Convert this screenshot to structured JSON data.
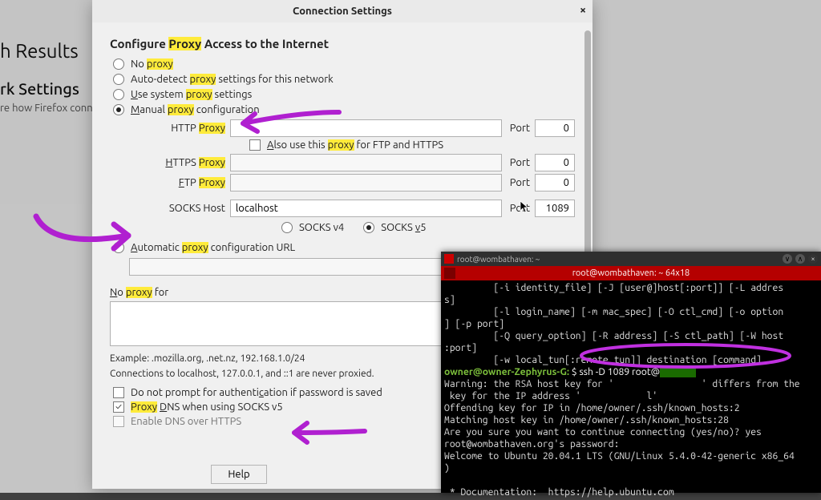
{
  "background": {
    "results_heading": "h Results",
    "settings_heading": "rk Settings",
    "settings_sub": "re how Firefox conne"
  },
  "dialog": {
    "title": "Connection Settings",
    "section_title_pre": "Configure ",
    "section_title_hl": "Proxy",
    "section_title_post": " Access to the Internet",
    "radios": {
      "no_proxy_pre": "No ",
      "no_proxy_hl": "proxy",
      "auto_pre": "Auto-detect ",
      "auto_hl": "proxy",
      "auto_post": " settings for this network",
      "system_pre": "se system ",
      "system_hl": "proxy",
      "system_post": " settings",
      "manual_pre": "anual ",
      "manual_hl": "proxy",
      "manual_post": " configuration",
      "pac_pre": "utomatic ",
      "pac_hl": "proxy",
      "pac_post": " configuration URL"
    },
    "fields": {
      "http_label_pre": "HTTP ",
      "http_label_hl": "Proxy",
      "also_pre": "lso use this ",
      "also_hl": "proxy",
      "also_post": " for FTP and HTTPS",
      "https_label_pre": "TTPS ",
      "https_label_hl": "Proxy",
      "ftp_label_pre": "TP ",
      "ftp_label_hl": "Proxy",
      "socks_label": "SOCKS Host",
      "port_label": "Port",
      "port_http": "0",
      "port_https": "0",
      "port_ftp": "0",
      "socks_host": "localhost",
      "port_socks": "1089",
      "socksv4": "SOCKS v4",
      "socksv5": "SOCKS ",
      "socksv5_u": "v",
      "socksv5_post": "5"
    },
    "noproxy": {
      "label_pre": "o ",
      "label_hl": "proxy",
      "label_post": " for",
      "example": "Example: .mozilla.org, .net.nz, 192.168.1.0/24",
      "never": "Connections to localhost, 127.0.0.1, and ::1 are never proxied."
    },
    "checks": {
      "noprompt": "Do not prompt for authentication if password is saved",
      "proxdns_hl": "Proxy",
      "proxdns_post": " ",
      "proxdns_u": "D",
      "proxdns_rest": "NS when using SOCKS v5",
      "dnsoverhttps": "Enable DNS over HTTPS"
    },
    "buttons": {
      "help": "Help"
    }
  },
  "terminal": {
    "tab_title": "root@wombathaven: ~",
    "title": "root@wombathaven: ~ 64x18",
    "prompt_user": "owner@owner-Zephyrus-G:",
    "lines": [
      "         [-i identity_file] [-J [user@]host[:port]] [-L addres",
      "s]",
      "         [-l login_name] [-m mac_spec] [-O ctl_cmd] [-o option",
      "] [-p port]",
      "         [-Q query_option] [-R address] [-S ctl_path] [-W host",
      ":port]",
      "         [-w local_tun[:remote_tun]] destination [command]",
      "$ ssh -D 1089 root@",
      "Warning: the RSA host key for '                ' differs from the",
      " key for the IP address '            l'",
      "Offending key for IP in /home/owner/.ssh/known_hosts:2",
      "Matching host key in /home/owner/.ssh/known_hosts:28",
      "Are you sure you want to continue connecting (yes/no)? yes",
      "root@wombathaven.org's password:",
      "Welcome to Ubuntu 20.04.1 LTS (GNU/Linux 5.4.0-42-generic x86_64",
      ")",
      "",
      " * Documentation:  https://help.ubuntu.com"
    ]
  }
}
